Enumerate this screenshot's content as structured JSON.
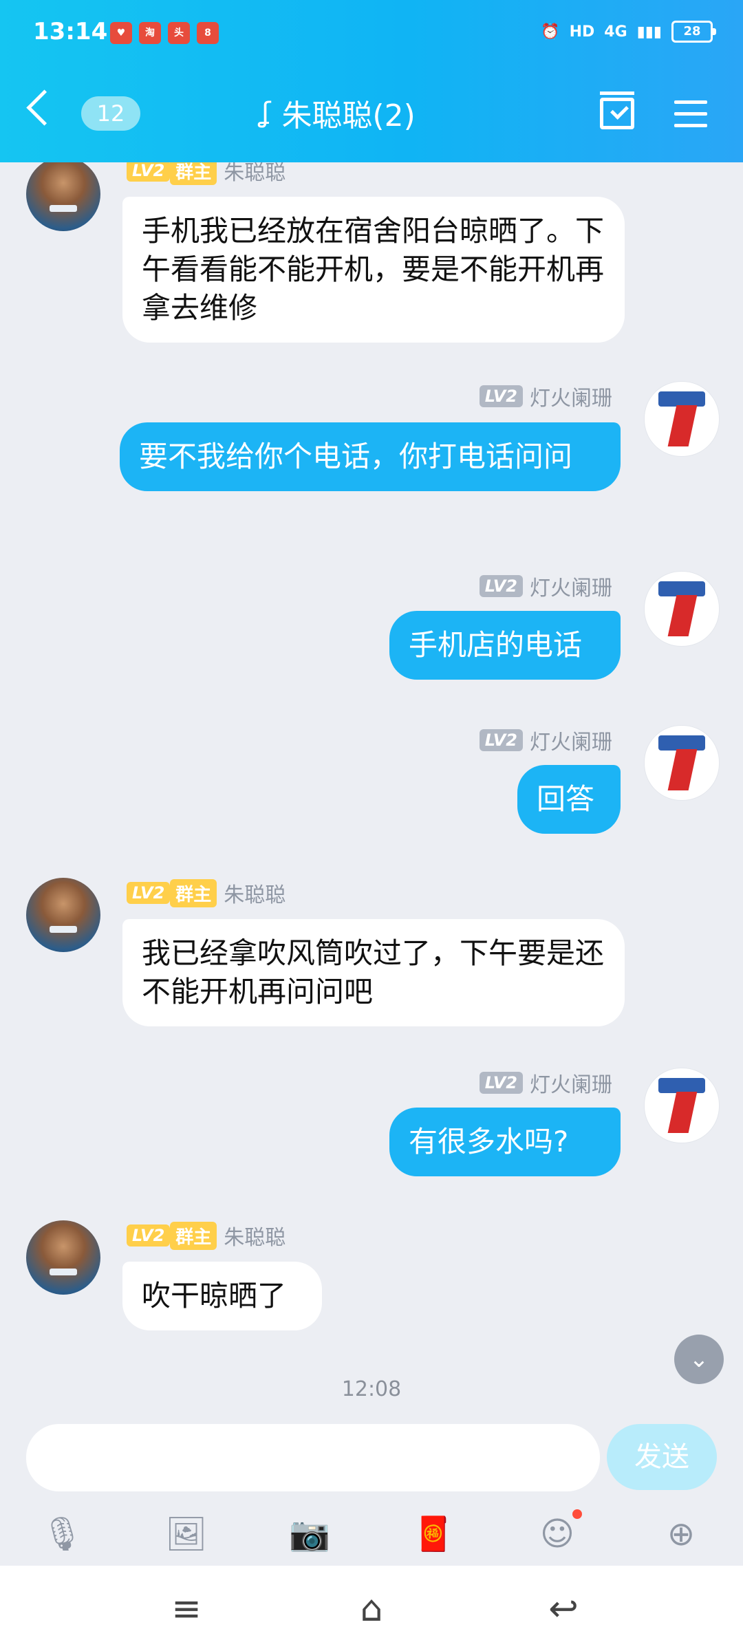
{
  "status_bar": {
    "time": "13:14",
    "notification_icons": [
      "app-notif-1",
      "app-notif-2",
      "app-notif-3",
      "app-notif-4"
    ],
    "hd_label": "HD",
    "network_label": "4G",
    "battery_level": "28"
  },
  "header": {
    "unread_count": "12",
    "title": "朱聪聪(2)"
  },
  "messages": [
    {
      "side": "left",
      "level": "LV2",
      "role": "群主",
      "sender": "朱聪聪",
      "text": "手机我已经放在宿舍阳台晾晒了。下午看看能不能开机，要是不能开机再拿去维修"
    },
    {
      "side": "right",
      "level": "LV2",
      "sender": "灯火阑珊",
      "text": "要不我给你个电话，你打电话问问"
    },
    {
      "side": "right",
      "level": "LV2",
      "sender": "灯火阑珊",
      "text": "手机店的电话"
    },
    {
      "side": "right",
      "level": "LV2",
      "sender": "灯火阑珊",
      "text": "回答"
    },
    {
      "side": "left",
      "level": "LV2",
      "role": "群主",
      "sender": "朱聪聪",
      "text": "我已经拿吹风筒吹过了，下午要是还不能开机再问问吧"
    },
    {
      "side": "right",
      "level": "LV2",
      "sender": "灯火阑珊",
      "text": "有很多水吗?"
    },
    {
      "side": "left",
      "level": "LV2",
      "role": "群主",
      "sender": "朱聪聪",
      "text": "吹干晾晒了"
    }
  ],
  "timestamp": "12:08",
  "input": {
    "placeholder": "",
    "send_label": "发送"
  },
  "toolbar_icons": [
    "microphone-icon",
    "image-icon",
    "camera-icon",
    "red-packet-icon",
    "emoji-icon",
    "plus-icon"
  ],
  "nav_icons": [
    "menu-nav-icon",
    "home-nav-icon",
    "back-nav-icon"
  ]
}
